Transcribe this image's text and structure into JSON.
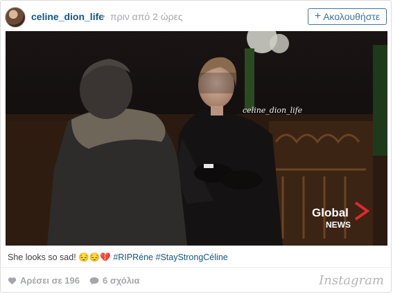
{
  "header": {
    "username": "celine_dion_life",
    "separator": "•",
    "time_ago": "πριν από 2 ώρες",
    "follow_label": "Ακολουθήστε",
    "follow_icon": "+"
  },
  "photo": {
    "watermark": "celine_dion_life",
    "logo_line1": "Global",
    "logo_line2": "NEWS"
  },
  "caption": {
    "text": "She looks so sad! ",
    "emoji": "😔😔💔",
    "hashtags": [
      " #RIPRéne",
      " #StayStrongCéline"
    ]
  },
  "footer": {
    "likes_label": "Αρέσει σε 196",
    "comments_label": "6 σχόλια",
    "brand": "Instagram"
  },
  "colors": {
    "link": "#125688",
    "follow": "#3f729b",
    "muted": "#a5a7aa"
  }
}
